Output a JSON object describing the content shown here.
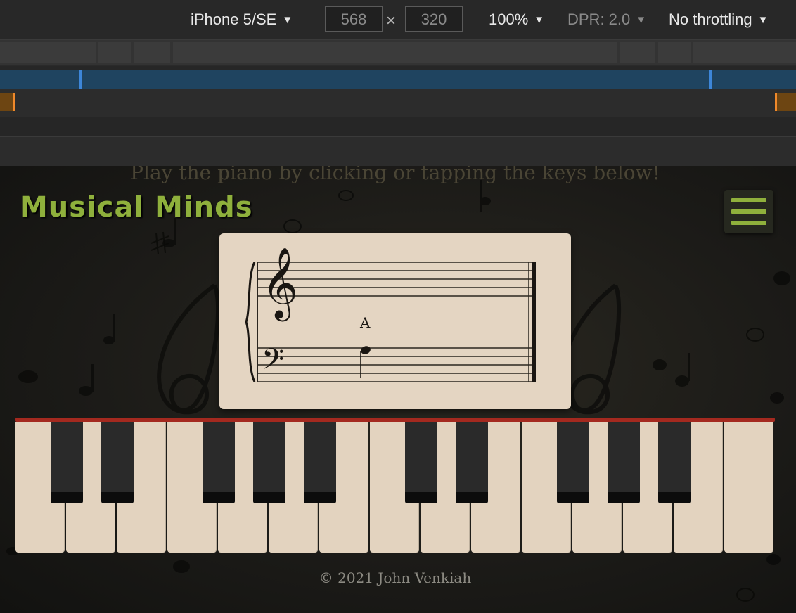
{
  "devtools": {
    "device": "iPhone 5/SE",
    "width": "568",
    "height": "320",
    "times": "×",
    "zoom": "100%",
    "dpr": "DPR: 2.0",
    "throttling": "No throttling",
    "caret": "▼"
  },
  "page": {
    "tagline": "Play the piano by clicking or tapping the keys below!",
    "brand": "Musical Minds",
    "menu_icon": "hamburger-icon",
    "note_label": "A",
    "footer": "© 2021 John Venkiah",
    "colors": {
      "brand": "#8fb03c",
      "piano_top": "#a4291f",
      "white_key": "#e3d3bf",
      "black_key": "#2a2a2a",
      "sheet": "#e4d5c2"
    }
  },
  "piano": {
    "white_key_count": 15,
    "black_key_count": 10
  }
}
